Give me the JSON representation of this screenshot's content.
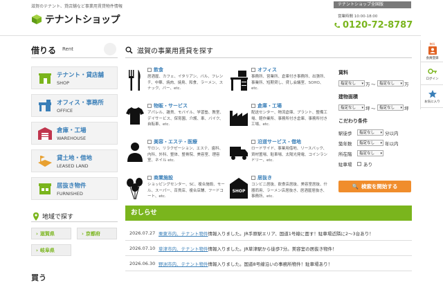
{
  "header": {
    "tagline": "滋賀のテナント、貸店舗など事業用賃貸物件情報",
    "logo_text": "テナントショップ",
    "all_branch": "テナントショップ全国版",
    "hours": "営業時間 10:00-18:00",
    "phone": "0120-72-8787"
  },
  "rent": {
    "title_jp": "借りる",
    "title_en": "Rent",
    "categories": [
      {
        "jp": "テナント・貸店舗",
        "en": "SHOP",
        "icon": "shop-icon"
      },
      {
        "jp": "オフィス・事務所",
        "en": "OFFICE",
        "icon": "office-icon"
      },
      {
        "jp": "倉庫・工場",
        "en": "WAREHOUSE",
        "icon": "warehouse-icon"
      },
      {
        "jp": "貸土地・借地",
        "en": "LEASED LAND",
        "icon": "land-icon"
      },
      {
        "jp": "居抜き物件",
        "en": "FURNISHED",
        "icon": "furnished-icon"
      }
    ]
  },
  "area": {
    "title": "地域で探す",
    "prefs": [
      "滋賀県",
      "京都府",
      "岐阜県"
    ]
  },
  "buy": {
    "title": "買う"
  },
  "main": {
    "title": "滋賀の事業用賃貸を探す",
    "types": [
      {
        "title": "飲食",
        "desc": "居酒屋、カフェ、イタリアン、バル、フレンチ、中華、焼肉、焼鳥、和食、ラーメン、スナック、バー、etc."
      },
      {
        "title": "オフィス",
        "desc": "事務所、営業所、倉庫付き事務所、出張所、事業所、短期貸し、貸し会議室、SOHO、etc."
      },
      {
        "title": "物販・サービス",
        "desc": "アパレル、雑貨、モバイル、学習塾、教室、デイサービス、保育園、介護、車、バイク、自転車、etc."
      },
      {
        "title": "倉庫・工場",
        "desc": "配送センター、物流倉庫、プラント、整備工場、軽作業所、事務所付き倉庫、事務所付き工場、etc."
      },
      {
        "title": "美容・エステ・医療",
        "desc": "サロン、リラクゼーション、エステ、歯科、内科、外科、整体、整骨院、美容室、理容室、ネイル etc."
      },
      {
        "title": "沿道サービス・借地",
        "desc": "ロードサイド、事業用借地、リースバック、資材置場、駐車場、太陽光発電、コインランドリー、etc."
      },
      {
        "title": "商業施設",
        "desc": "ショッピングセンター、SC、複合施設、モール、スーパー、百貨店、複合店舗、フードコート、etc."
      },
      {
        "title": "居抜き",
        "desc": "コンビニ居抜、飲食店居抜、美容室居抜、什器而用、ラーメン店居抜き、居酒屋居抜き、事務所、etc."
      }
    ]
  },
  "filters": {
    "rent_label": "賃料",
    "area_label": "建物面積",
    "conditions_label": "こだわり条件",
    "unset": "指定なし",
    "unit_man": "万",
    "unit_tsubo": "坪",
    "tilde": "〜",
    "walk_label": "駅徒歩",
    "walk_unit": "分以内",
    "age_label": "築年数",
    "age_unit": "年以内",
    "floor_label": "所在階",
    "parking_label": "駐車場",
    "parking_opt": "あり",
    "search_button": "検索を開始する"
  },
  "news": {
    "title": "おしらせ",
    "items": [
      {
        "date": "2026.07.27",
        "link": "栗東市内、テナント物件",
        "text": "情報入りました。JR手原駅エリア、国道1号線に面す！駐車場近隣に2〜3台あり！"
      },
      {
        "date": "2026.07.10",
        "link": "草津市内、テナント物件",
        "text": "情報入りました。JR草津駅から徒歩7分。美容室の居抜き物件！"
      },
      {
        "date": "2026.06.30",
        "link": "野洲市内、テナント物件",
        "text": "情報入りました。国道8号線沿いの事務所物件！駐車場あり！"
      }
    ]
  },
  "side": {
    "register": "会員登録",
    "login": "ログイン",
    "favorite": "お気に入り",
    "top": "無料"
  },
  "colors": {
    "green": "#7ab51d",
    "blue": "#3a7fb8",
    "orange": "#f08d2c"
  }
}
